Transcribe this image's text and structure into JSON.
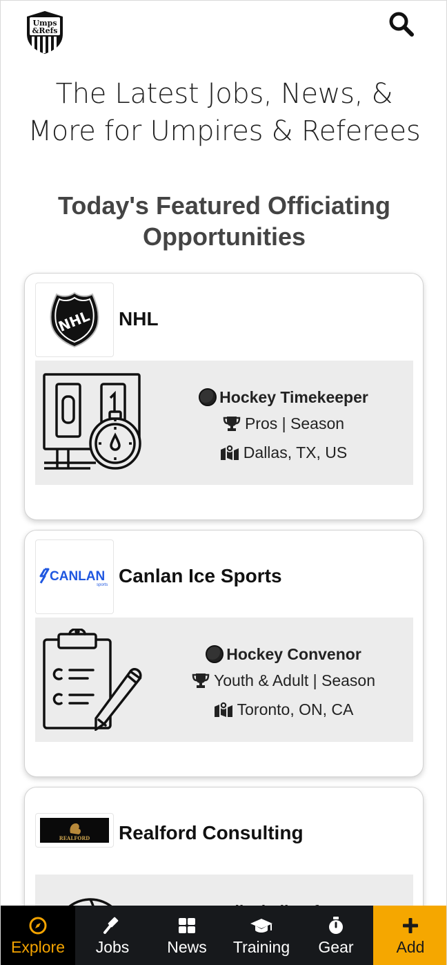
{
  "header": {
    "logo_text_line1": "Umps",
    "logo_text_line2": "&Refs",
    "search_icon": "search-icon"
  },
  "headline": {
    "line1": "The Latest Jobs, News, &",
    "line2": "More for Umpires & Referees"
  },
  "featured": {
    "title_line1": "Today's Featured Officiating",
    "title_line2": "Opportunities"
  },
  "cards": [
    {
      "org": "NHL",
      "logo_text": "NHL",
      "illustration": "scoreboard-stopwatch-icon",
      "job_title": "Hockey Timekeeper",
      "level": "Pros | Season",
      "location": "Dallas, TX, US"
    },
    {
      "org": "Canlan Ice Sports",
      "logo_text": "CANLAN",
      "logo_subtext": "sports",
      "illustration": "clipboard-pen-icon",
      "job_title": "Hockey Convenor",
      "level": "Youth & Adult | Season",
      "location": "Toronto, ON, CA"
    },
    {
      "org": "Realford Consulting",
      "logo_text": "REALFORD",
      "illustration": "volleyball-icon",
      "job_title": "Volleyball Referee"
    }
  ],
  "bottom_nav": [
    {
      "label": "Explore",
      "icon": "compass-icon",
      "active": true
    },
    {
      "label": "Jobs",
      "icon": "gavel-icon"
    },
    {
      "label": "News",
      "icon": "grid-icon"
    },
    {
      "label": "Training",
      "icon": "graduation-cap-icon"
    },
    {
      "label": "Gear",
      "icon": "stopwatch-icon"
    },
    {
      "label": "Add",
      "icon": "plus-icon"
    }
  ],
  "colors": {
    "accent": "#f5a700",
    "nav_bg": "#17191c",
    "panel_bg": "#ececec",
    "canlan_blue": "#1f57e0"
  }
}
